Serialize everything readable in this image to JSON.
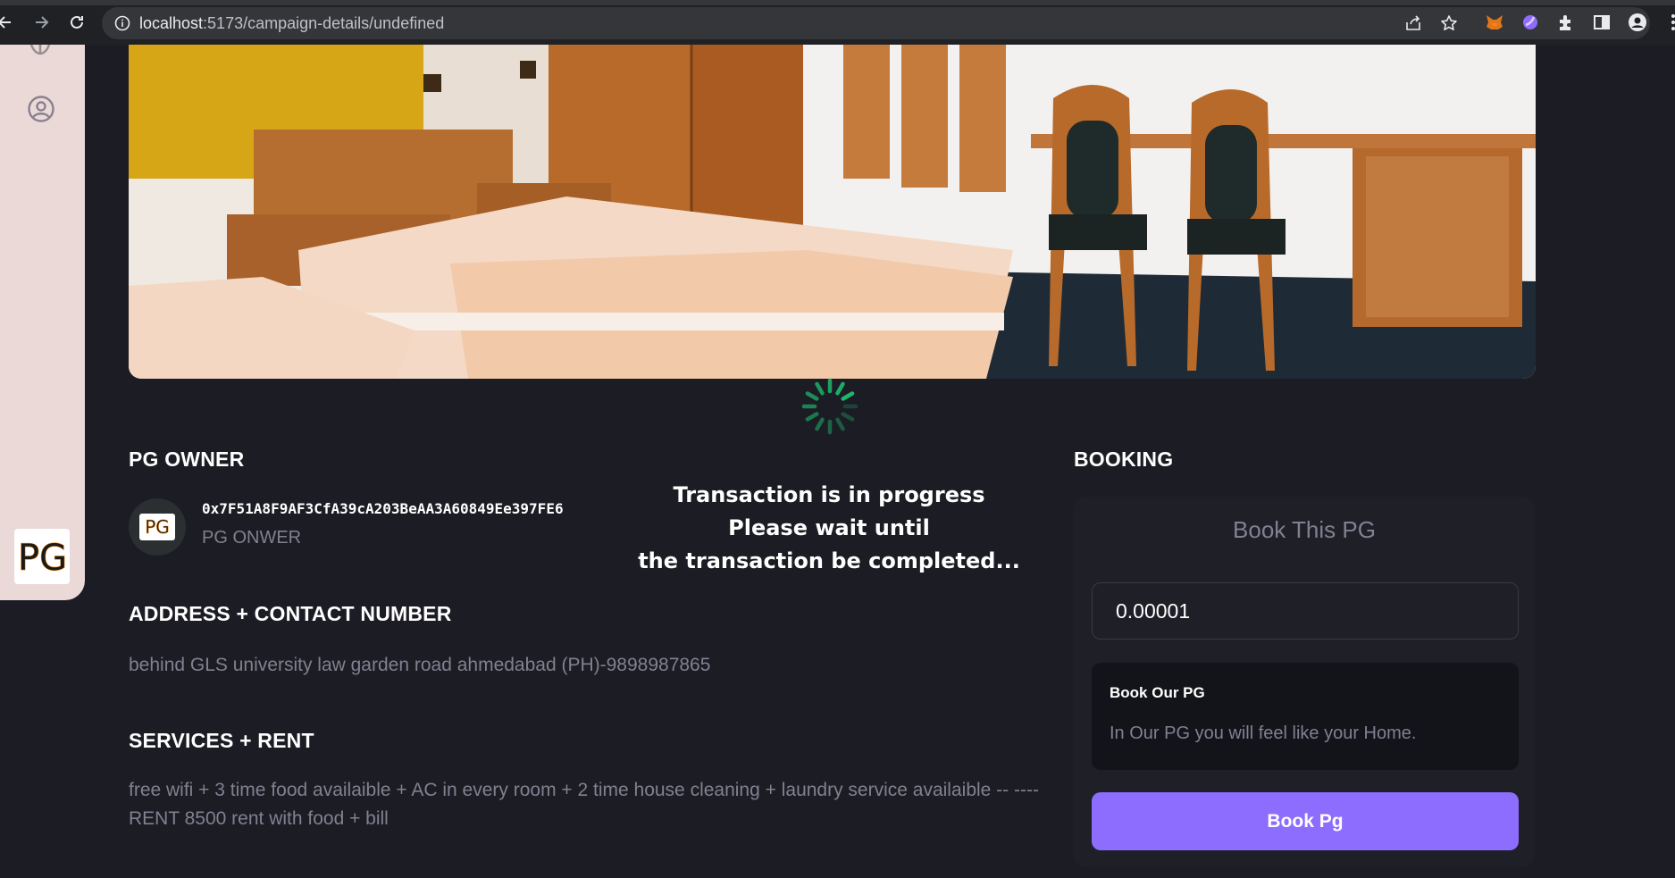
{
  "browser": {
    "url_host": "localhost",
    "url_path": ":5173/campaign-details/undefined"
  },
  "sidebar": {
    "logo_text": "PG"
  },
  "owner": {
    "heading": "PG OWNER",
    "address": "0x7F51A8F9AF3CfA39cA203BeAA3A60849Ee397FE6",
    "role": "PG ONWER",
    "avatar_text": "PG"
  },
  "address_section": {
    "heading": "ADDRESS + CONTACT NUMBER",
    "text": "behind GLS university law garden road ahmedabad (PH)-9898987865"
  },
  "services_section": {
    "heading": "SERVICES + RENT",
    "text": "free wifi + 3 time food availaible + AC in every room + 2 time house cleaning + laundry service availaible -- ----RENT 8500 rent with food + bill"
  },
  "loader": {
    "line1": "Transaction is in progress",
    "line2": "Please wait until",
    "line3": "the transaction be completed..."
  },
  "booking": {
    "heading": "BOOKING",
    "card_title": "Book This PG",
    "amount_value": "0.00001",
    "info_title": "Book Our PG",
    "info_text": "In Our PG you will feel like your Home.",
    "button_label": "Book Pg"
  },
  "colors": {
    "background": "#1c1c24",
    "card": "#1f1f27",
    "accent": "#8c6dfd",
    "muted_text": "#808191",
    "sidebar": "#ead9d7",
    "loader": "#1dc071"
  }
}
